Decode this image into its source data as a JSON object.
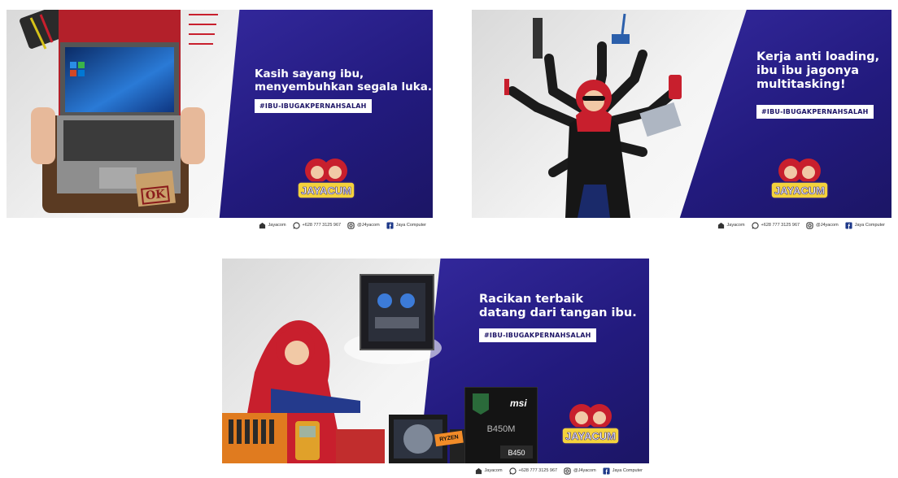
{
  "banners": [
    {
      "headline_lines": [
        "Kasih sayang ibu,",
        "menyembuhkan segala luka."
      ],
      "hashtag": "#IBU-IBUGAKPERNAHSALAH",
      "stamp": "OK"
    },
    {
      "headline_lines": [
        "Kerja anti loading,",
        "ibu ibu jagonya",
        "multitasking!"
      ],
      "hashtag": "#IBU-IBUGAKPERNAHSALAH"
    },
    {
      "headline_lines": [
        "Racikan terbaik",
        "datang dari tangan ibu."
      ],
      "hashtag": "#IBU-IBUGAKPERNAHSALAH",
      "product_labels": [
        "msi",
        "B450M",
        "B450",
        "RYZEN"
      ]
    }
  ],
  "logo_text": "JAYACUM",
  "footer": {
    "website": "Jayacom",
    "whatsapp": "+628 777 3125 967",
    "instagram": "@J4yacom",
    "facebook": "Jaya Computer"
  },
  "colors": {
    "brand_blue": "#221a7d",
    "accent_red": "#c81f2d",
    "white": "#ffffff"
  },
  "icons": [
    "store-icon",
    "whatsapp-icon",
    "instagram-icon",
    "facebook-icon"
  ]
}
